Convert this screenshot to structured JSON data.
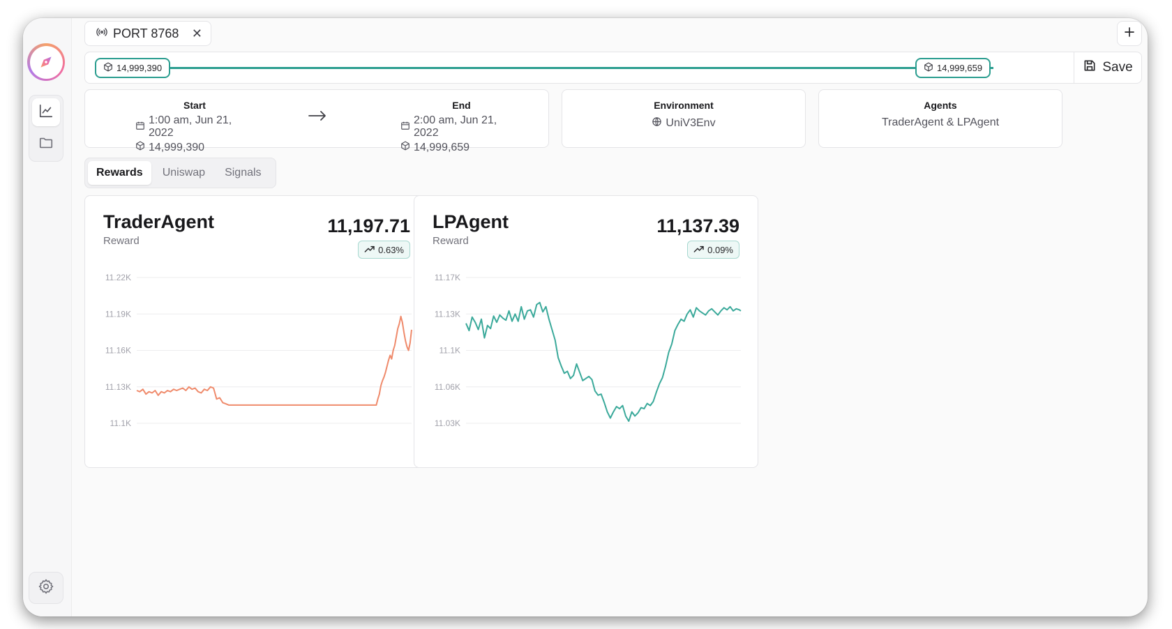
{
  "tab": {
    "label": "PORT 8768"
  },
  "range": {
    "start_block": "14,999,390",
    "end_block": "14,999,659",
    "save_label": "Save"
  },
  "period": {
    "start_title": "Start",
    "start_time": "1:00 am, Jun 21, 2022",
    "start_block": "14,999,390",
    "end_title": "End",
    "end_time": "2:00 am, Jun 21, 2022",
    "end_block": "14,999,659"
  },
  "environment": {
    "title": "Environment",
    "value": "UniV3Env"
  },
  "agents": {
    "title": "Agents",
    "value": "TraderAgent & LPAgent"
  },
  "tabs": [
    {
      "label": "Rewards",
      "active": true
    },
    {
      "label": "Uniswap",
      "active": false
    },
    {
      "label": "Signals",
      "active": false
    }
  ],
  "colors": {
    "accent": "#2a9d8f",
    "trader_line": "#ef8a6b",
    "lp_line": "#3aa99a"
  },
  "chart_data": [
    {
      "type": "line",
      "title": "TraderAgent",
      "subtitle": "Reward",
      "value": "11,197.71",
      "change": "0.63%",
      "yticks": [
        "11.22K",
        "11.19K",
        "11.16K",
        "11.13K",
        "11.1K"
      ],
      "ylim": [
        11100,
        11220
      ],
      "x": [
        0,
        4,
        8,
        12,
        16,
        20,
        24,
        28,
        32,
        36,
        40,
        44,
        48,
        52,
        56,
        60,
        64,
        68,
        72,
        76,
        80,
        84,
        88,
        92,
        96,
        100,
        104,
        108,
        112,
        116,
        120,
        124,
        128,
        132,
        136,
        140,
        144,
        148,
        152,
        156,
        160,
        164,
        168,
        172,
        176,
        180,
        184,
        188,
        192,
        196,
        200,
        204,
        208,
        212,
        216,
        220,
        224,
        228,
        232,
        236,
        240,
        244,
        248,
        252,
        256,
        258,
        260,
        262,
        264,
        266,
        268,
        270,
        272,
        274,
        276,
        278,
        280,
        282,
        284,
        286,
        288,
        290,
        292,
        294,
        296,
        298,
        300,
        302,
        304,
        306,
        308,
        310,
        312,
        314,
        316,
        318,
        320,
        322,
        324,
        326,
        328,
        330,
        332,
        334,
        336,
        338,
        340,
        342,
        344,
        346,
        348,
        350,
        352,
        354,
        356,
        358
      ],
      "y": [
        11127,
        11126,
        11128,
        11124,
        11126,
        11125,
        11127,
        11123,
        11126,
        11125,
        11127,
        11126,
        11128,
        11127,
        11128,
        11129,
        11127,
        11130,
        11128,
        11129,
        11126,
        11125,
        11128,
        11127,
        11130,
        11129,
        11120,
        11121,
        11117,
        11116,
        11115,
        11115,
        11115,
        11115,
        11115,
        11115,
        11115,
        11115,
        11115,
        11115,
        11115,
        11115,
        11115,
        11115,
        11115,
        11115,
        11115,
        11115,
        11115,
        11115,
        11115,
        11115,
        11115,
        11115,
        11115,
        11115,
        11115,
        11115,
        11115,
        11115,
        11115,
        11115,
        11115,
        11115,
        11115,
        11115,
        11115,
        11115,
        11115,
        11115,
        11115,
        11115,
        11115,
        11115,
        11115,
        11115,
        11115,
        11115,
        11115,
        11115,
        11115,
        11115,
        11115,
        11115,
        11115,
        11115,
        11115,
        11115,
        11115,
        11115,
        11115,
        11115,
        11115,
        11120,
        11124,
        11131,
        11135,
        11138,
        11142,
        11147,
        11152,
        11156,
        11153,
        11160,
        11164,
        11171,
        11178,
        11182,
        11188,
        11183,
        11175,
        11168,
        11163,
        11160,
        11166,
        11177
      ]
    },
    {
      "type": "line",
      "title": "LPAgent",
      "subtitle": "Reward",
      "value": "11,137.39",
      "change": "0.09%",
      "yticks": [
        "11.17K",
        "11.13K",
        "11.1K",
        "11.06K",
        "11.03K"
      ],
      "ylim": [
        11030,
        11170
      ],
      "x": [
        0,
        4,
        8,
        12,
        16,
        20,
        24,
        28,
        32,
        36,
        40,
        44,
        48,
        52,
        56,
        60,
        64,
        68,
        72,
        76,
        80,
        84,
        88,
        92,
        96,
        100,
        104,
        108,
        112,
        116,
        120,
        124,
        128,
        132,
        136,
        140,
        144,
        148,
        152,
        156,
        160,
        164,
        168,
        172,
        176,
        180,
        184,
        188,
        192,
        196,
        200,
        204,
        208,
        212,
        216,
        220,
        224,
        228,
        232,
        236,
        240,
        244,
        248,
        252,
        256,
        260,
        264,
        268,
        272,
        276,
        280,
        284,
        288,
        292,
        296,
        300,
        304,
        308,
        312,
        316,
        320,
        324,
        328,
        332,
        336,
        340,
        344,
        348,
        352,
        356,
        358
      ],
      "y": [
        11126,
        11119,
        11132,
        11127,
        11120,
        11130,
        11112,
        11124,
        11121,
        11133,
        11127,
        11134,
        11131,
        11129,
        11138,
        11128,
        11135,
        11128,
        11142,
        11130,
        11138,
        11139,
        11132,
        11144,
        11146,
        11137,
        11142,
        11130,
        11120,
        11110,
        11093,
        11085,
        11078,
        11080,
        11073,
        11076,
        11087,
        11079,
        11071,
        11073,
        11075,
        11072,
        11061,
        11057,
        11058,
        11050,
        11041,
        11035,
        11041,
        11046,
        11044,
        11047,
        11037,
        11032,
        11041,
        11037,
        11040,
        11045,
        11044,
        11049,
        11047,
        11051,
        11060,
        11068,
        11074,
        11085,
        11098,
        11106,
        11119,
        11125,
        11130,
        11128,
        11135,
        11139,
        11132,
        11141,
        11138,
        11136,
        11134,
        11138,
        11140,
        11137,
        11134,
        11138,
        11141,
        11139,
        11142,
        11138,
        11140,
        11139,
        11138
      ]
    }
  ]
}
